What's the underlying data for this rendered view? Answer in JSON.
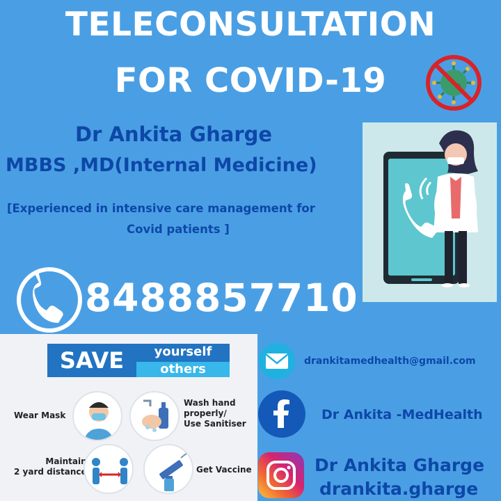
{
  "header": {
    "title_line1": "TELECONSULTATION",
    "title_line2": "FOR COVID-19"
  },
  "doctor": {
    "name": "Dr Ankita Gharge",
    "degree": "MBBS ,MD(Internal Medicine)",
    "experience_line1": "[Experienced in intensive care management for",
    "experience_line2": "Covid patients ]"
  },
  "phone": {
    "number": "8488857710"
  },
  "tips": {
    "save": "SAVE",
    "yourself": "yourself",
    "others": "others",
    "wear_mask": "Wear Mask",
    "wash_hand_1": "Wash hand",
    "wash_hand_2": "properly/",
    "wash_hand_3": "Use Sanitiser",
    "distance_1": "Maintain",
    "distance_2": "2 yard distance",
    "vaccine": "Get Vaccine"
  },
  "contacts": {
    "email": "drankitamedhealth@gmail.com",
    "facebook": "Dr Ankita -MedHealth",
    "instagram_name": "Dr Ankita Gharge",
    "instagram_handle": "drankita.gharge"
  },
  "colors": {
    "background": "#4a9fe4",
    "text_dark_blue": "#0d47a8",
    "white": "#ffffff"
  },
  "icons": [
    "no-covid-icon",
    "phone-icon",
    "email-icon",
    "facebook-icon",
    "instagram-icon"
  ]
}
